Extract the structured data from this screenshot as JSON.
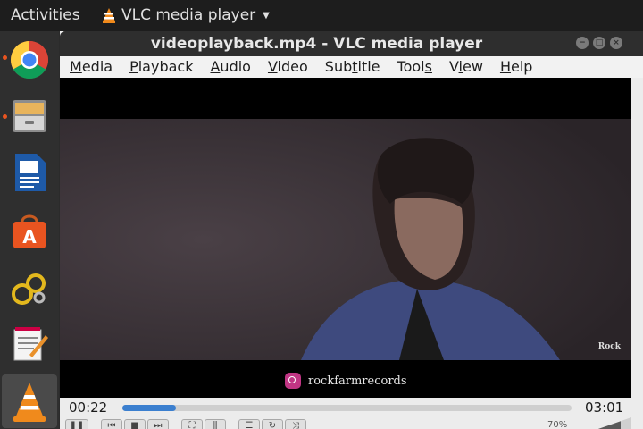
{
  "topbar": {
    "activities": "Activities",
    "app_name": "VLC media player"
  },
  "dock": {
    "items": [
      {
        "name": "chrome-icon"
      },
      {
        "name": "files-icon"
      },
      {
        "name": "writer-icon"
      },
      {
        "name": "software-center-icon"
      },
      {
        "name": "settings-gears-icon"
      },
      {
        "name": "text-editor-icon"
      },
      {
        "name": "vlc-icon"
      }
    ]
  },
  "window": {
    "title": "videoplayback.mp4 - VLC media player",
    "menu": [
      "Media",
      "Playback",
      "Audio",
      "Video",
      "Subtitle",
      "Tools",
      "View",
      "Help"
    ],
    "mnemonic": [
      "M",
      "P",
      "A",
      "V",
      "t",
      "s",
      "i",
      "H"
    ]
  },
  "video": {
    "caption": "rockfarmrecords",
    "watermark": "Rock"
  },
  "controls": {
    "elapsed": "00:22",
    "total": "03:01",
    "progress": 0.12,
    "volume": "70%"
  },
  "colors": {
    "accent": "#e95420",
    "seek_fill": "#3b7fcf"
  }
}
